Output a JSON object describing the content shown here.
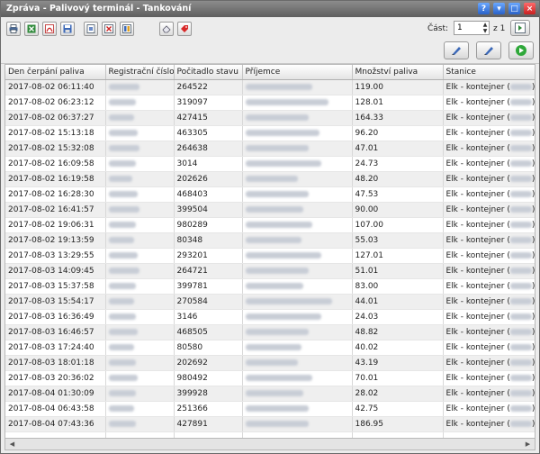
{
  "window": {
    "title": "Zpráva - Palivový terminál - Tankování"
  },
  "pager": {
    "label": "Část:",
    "value": "1",
    "of_label": "z 1"
  },
  "grid": {
    "columns": [
      "Den čerpání paliva",
      "Registrační číslo",
      "Počitadlo stavu",
      "Příjemce",
      "Množství paliva",
      "Stanice"
    ],
    "rows": [
      {
        "date": "2017-08-02 06:11:40",
        "counter": "264522",
        "amount": "119.00",
        "station": "Elk - kontejner"
      },
      {
        "date": "2017-08-02 06:23:12",
        "counter": "319097",
        "amount": "128.01",
        "station": "Elk - kontejner"
      },
      {
        "date": "2017-08-02 06:37:27",
        "counter": "427415",
        "amount": "164.33",
        "station": "Elk - kontejner"
      },
      {
        "date": "2017-08-02 15:13:18",
        "counter": "463305",
        "amount": "96.20",
        "station": "Elk - kontejner"
      },
      {
        "date": "2017-08-02 15:32:08",
        "counter": "264638",
        "amount": "47.01",
        "station": "Elk - kontejner"
      },
      {
        "date": "2017-08-02 16:09:58",
        "counter": "3014",
        "amount": "24.73",
        "station": "Elk - kontejner"
      },
      {
        "date": "2017-08-02 16:19:58",
        "counter": "202626",
        "amount": "48.20",
        "station": "Elk - kontejner"
      },
      {
        "date": "2017-08-02 16:28:30",
        "counter": "468403",
        "amount": "47.53",
        "station": "Elk - kontejner"
      },
      {
        "date": "2017-08-02 16:41:57",
        "counter": "399504",
        "amount": "90.00",
        "station": "Elk - kontejner"
      },
      {
        "date": "2017-08-02 19:06:31",
        "counter": "980289",
        "amount": "107.00",
        "station": "Elk - kontejner"
      },
      {
        "date": "2017-08-02 19:13:59",
        "counter": "80348",
        "amount": "55.03",
        "station": "Elk - kontejner"
      },
      {
        "date": "2017-08-03 13:29:55",
        "counter": "293201",
        "amount": "127.01",
        "station": "Elk - kontejner"
      },
      {
        "date": "2017-08-03 14:09:45",
        "counter": "264721",
        "amount": "51.01",
        "station": "Elk - kontejner"
      },
      {
        "date": "2017-08-03 15:37:58",
        "counter": "399781",
        "amount": "83.00",
        "station": "Elk - kontejner"
      },
      {
        "date": "2017-08-03 15:54:17",
        "counter": "270584",
        "amount": "44.01",
        "station": "Elk - kontejner"
      },
      {
        "date": "2017-08-03 16:36:49",
        "counter": "3146",
        "amount": "24.03",
        "station": "Elk - kontejner"
      },
      {
        "date": "2017-08-03 16:46:57",
        "counter": "468505",
        "amount": "48.82",
        "station": "Elk - kontejner"
      },
      {
        "date": "2017-08-03 17:24:40",
        "counter": "80580",
        "amount": "40.02",
        "station": "Elk - kontejner"
      },
      {
        "date": "2017-08-03 18:01:18",
        "counter": "202692",
        "amount": "43.19",
        "station": "Elk - kontejner"
      },
      {
        "date": "2017-08-03 20:36:02",
        "counter": "980492",
        "amount": "70.01",
        "station": "Elk - kontejner"
      },
      {
        "date": "2017-08-04 01:30:09",
        "counter": "399928",
        "amount": "28.02",
        "station": "Elk - kontejner"
      },
      {
        "date": "2017-08-04 06:43:58",
        "counter": "251366",
        "amount": "42.75",
        "station": "Elk - kontejner"
      },
      {
        "date": "2017-08-04 07:43:36",
        "counter": "427891",
        "amount": "186.95",
        "station": "Elk - kontejner"
      }
    ]
  },
  "colors": {
    "titlebar": "#6e6e6e",
    "row_alt": "#efefef",
    "close_button": "#c82020"
  },
  "icons": [
    "print-icon",
    "excel-export-icon",
    "pdf-export-icon",
    "save-icon",
    "page-setup-icon",
    "delete-icon",
    "columns-icon",
    "eraser-icon",
    "tag-icon",
    "next-page-icon",
    "edit-pen-icon",
    "edit-pen-icon",
    "refresh-icon"
  ]
}
